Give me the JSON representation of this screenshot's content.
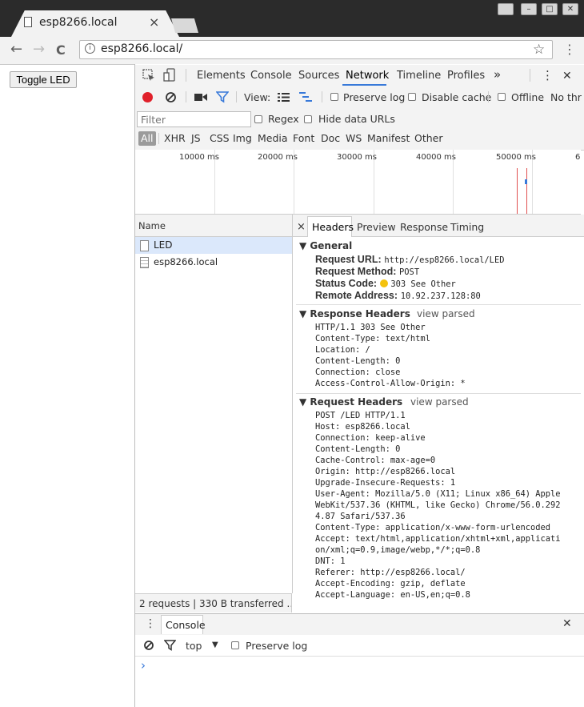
{
  "browser": {
    "tab_title": "esp8266.local",
    "tab_close": "×",
    "url": "esp8266.local/",
    "back_icon": "←",
    "forward_icon": "→",
    "reload_icon": "C",
    "info_icon": "i",
    "star_icon": "☆",
    "menu_icon": "⋮"
  },
  "page": {
    "toggle_button": "Toggle LED"
  },
  "devtools": {
    "tabs": [
      "Elements",
      "Console",
      "Sources",
      "Network",
      "Timeline",
      "Profiles",
      "»"
    ],
    "active_tab": "Network",
    "close_icon": "✕",
    "menu_icon": "⋮",
    "toolbar": {
      "view_label": "View:",
      "preserve_log": "Preserve log",
      "disable_cache": "Disable cache",
      "offline": "Offline",
      "throttle": "No thr"
    },
    "filter": {
      "placeholder": "Filter",
      "regex": "Regex",
      "hide_data_urls": "Hide data URLs",
      "types": [
        "All",
        "XHR",
        "JS",
        "CSS",
        "Img",
        "Media",
        "Font",
        "Doc",
        "WS",
        "Manifest",
        "Other"
      ]
    },
    "timeline": {
      "ticks": [
        "10000 ms",
        "20000 ms",
        "30000 ms",
        "40000 ms",
        "50000 ms",
        "6"
      ]
    },
    "requests": {
      "column": "Name",
      "rows": [
        "LED",
        "esp8266.local"
      ],
      "summary": "2 requests  |  330 B transferred  …"
    },
    "details": {
      "close": "×",
      "tabs": [
        "Headers",
        "Preview",
        "Response",
        "Timing"
      ],
      "general": {
        "title": "▼ General",
        "request_url_label": "Request URL:",
        "request_url": "http://esp8266.local/LED",
        "request_method_label": "Request Method:",
        "request_method": "POST",
        "status_code_label": "Status Code:",
        "status_code": "303 See Other",
        "remote_address_label": "Remote Address:",
        "remote_address": "10.92.237.128:80"
      },
      "response_headers": {
        "title": "▼ Response Headers",
        "view_parsed": "view parsed",
        "lines": [
          "HTTP/1.1 303 See Other",
          "Content-Type: text/html",
          "Location: /",
          "Content-Length: 0",
          "Connection: close",
          "Access-Control-Allow-Origin: *"
        ]
      },
      "request_headers": {
        "title": "▼ Request Headers",
        "view_parsed": "view parsed",
        "lines": [
          "POST /LED HTTP/1.1",
          "Host: esp8266.local",
          "Connection: keep-alive",
          "Content-Length: 0",
          "Cache-Control: max-age=0",
          "Origin: http://esp8266.local",
          "Upgrade-Insecure-Requests: 1",
          "User-Agent: Mozilla/5.0 (X11; Linux x86_64) Apple",
          "WebKit/537.36 (KHTML, like Gecko) Chrome/56.0.292",
          "4.87 Safari/537.36",
          "Content-Type: application/x-www-form-urlencoded",
          "Accept: text/html,application/xhtml+xml,applicati",
          "on/xml;q=0.9,image/webp,*/*;q=0.8",
          "DNT: 1",
          "Referer: http://esp8266.local/",
          "Accept-Encoding: gzip, deflate",
          "Accept-Language: en-US,en;q=0.8"
        ]
      }
    },
    "drawer": {
      "menu_icon": "⋮",
      "tab": "Console",
      "close": "✕",
      "context": "top",
      "preserve_log": "Preserve log",
      "prompt": "›"
    }
  },
  "colors": {
    "record_red": "#e0202a",
    "active_blue": "#3879d9",
    "status_yellow": "#f4c20d"
  }
}
